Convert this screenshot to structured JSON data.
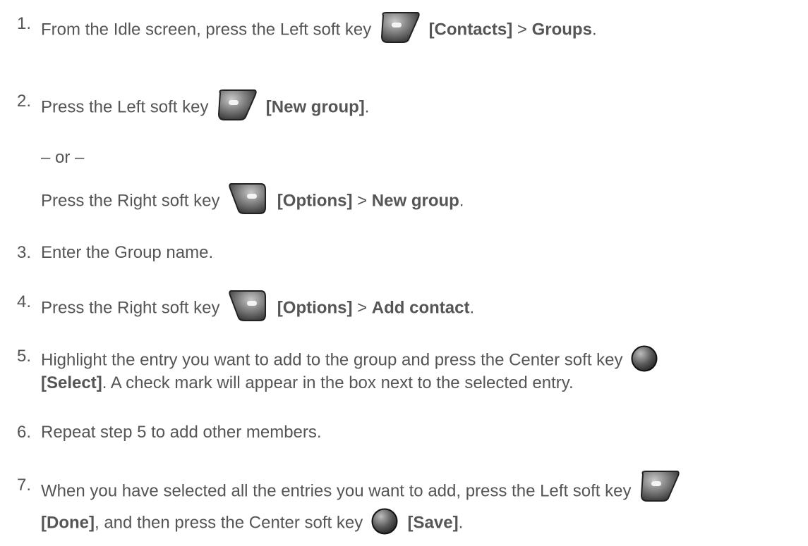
{
  "steps": [
    {
      "num": "1.",
      "pre": "From the Idle screen, press the Left soft key",
      "key": "left-soft-key",
      "b1": "[Contacts]",
      "sep": " > ",
      "b2": "Groups",
      "end": "."
    },
    {
      "num": "2.",
      "pre": "Press the Left soft key",
      "key": "left-soft-key",
      "b1": "[New group]",
      "end": "."
    },
    {
      "or": "– or –"
    },
    {
      "pre": "Press the Right soft key",
      "key": "right-soft-key",
      "b1": "[Options]",
      "sep": " > ",
      "b2": "New group",
      "end": "."
    },
    {
      "num": "3.",
      "pre": "Enter the Group name."
    },
    {
      "num": "4.",
      "pre": "Press the Right soft key",
      "key": "right-soft-key",
      "b1": "[Options]",
      "sep": " > ",
      "b2": "Add contact",
      "end": "."
    },
    {
      "num": "5.",
      "pre": "Highlight the entry you want to add to the group and press the Center soft key",
      "key": "center-soft-key",
      "line2_b": "[Select]",
      "line2_rest": ". A check mark will appear in the box next to the selected entry."
    },
    {
      "num": "6.",
      "pre": "Repeat step 5 to add other members."
    },
    {
      "num": "7.",
      "pre": "When you have selected all the entries you want to add, press the Left soft key",
      "key": "left-soft-key",
      "line2_b": "[Done]",
      "line2_mid": ", and then press the Center soft key",
      "key2": "center-soft-key",
      "line2_b2": "[Save]",
      "line2_end": "."
    }
  ]
}
